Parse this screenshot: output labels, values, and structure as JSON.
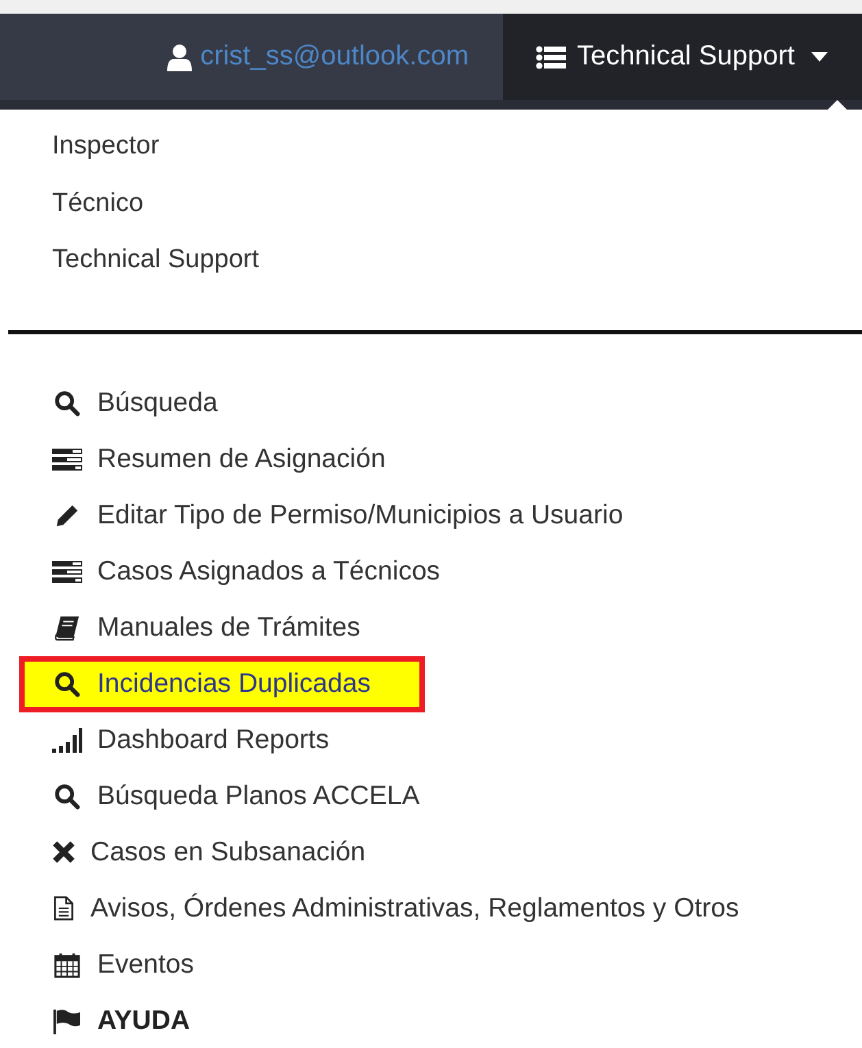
{
  "navbar": {
    "user": {
      "email": "crist_ss@outlook.com"
    },
    "role_menu": {
      "label": "Technical Support",
      "expanded": true,
      "options": [
        {
          "label": "Inspector"
        },
        {
          "label": "Técnico"
        },
        {
          "label": "Technical Support"
        }
      ]
    }
  },
  "menu": [
    {
      "label": "Búsqueda",
      "kind": "search",
      "highlighted": false,
      "bold": false
    },
    {
      "label": "Resumen de Asignación",
      "kind": "tasks",
      "highlighted": false,
      "bold": false
    },
    {
      "label": "Editar Tipo de Permiso/Municipios a Usuario",
      "kind": "pencil",
      "highlighted": false,
      "bold": false
    },
    {
      "label": "Casos Asignados a Técnicos",
      "kind": "tasks",
      "highlighted": false,
      "bold": false
    },
    {
      "label": "Manuales de Trámites",
      "kind": "book",
      "highlighted": false,
      "bold": false
    },
    {
      "label": "Incidencias Duplicadas",
      "kind": "search",
      "highlighted": true,
      "bold": false
    },
    {
      "label": "Dashboard Reports",
      "kind": "signal",
      "highlighted": false,
      "bold": false
    },
    {
      "label": "Búsqueda Planos ACCELA",
      "kind": "search",
      "highlighted": false,
      "bold": false
    },
    {
      "label": "Casos en Subsanación",
      "kind": "times",
      "highlighted": false,
      "bold": false
    },
    {
      "label": "Avisos, Órdenes Administrativas, Reglamentos y Otros",
      "kind": "file",
      "highlighted": false,
      "bold": false
    },
    {
      "label": "Eventos",
      "kind": "calendar",
      "highlighted": false,
      "bold": false
    },
    {
      "label": "AYUDA",
      "kind": "flag",
      "highlighted": false,
      "bold": true
    }
  ]
}
